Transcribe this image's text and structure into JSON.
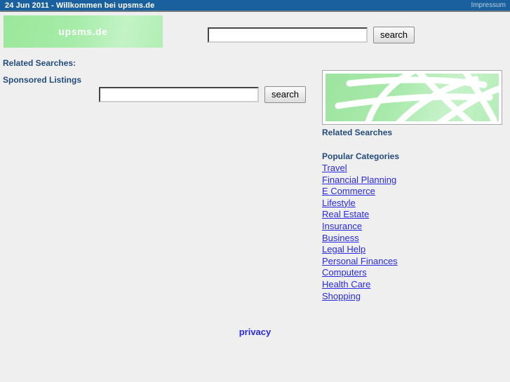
{
  "header": {
    "title": "24 Jun 2011 - Willkommen bei upsms.de",
    "impressum_label": "Impressum",
    "background_color": "#1a609e"
  },
  "logo": {
    "text": "upsms.de",
    "background_color": "#a7ecaa"
  },
  "top_search": {
    "value": "",
    "placeholder": "",
    "button_label": "search"
  },
  "main_search": {
    "value": "",
    "placeholder": "",
    "button_label": "search"
  },
  "left_column": {
    "related_searches_heading": "Related Searches:",
    "sponsored_listings_heading": "Sponsored Listings"
  },
  "banner": {
    "caption": "Related Searches",
    "graphic_name": "green-globe-grid",
    "graphic_color": "#a8e9ab"
  },
  "categories": {
    "heading": "Popular Categories",
    "items": [
      {
        "label": "Travel"
      },
      {
        "label": "Financial Planning"
      },
      {
        "label": "E Commerce"
      },
      {
        "label": "Lifestyle"
      },
      {
        "label": "Real Estate"
      },
      {
        "label": "Insurance"
      },
      {
        "label": "Business"
      },
      {
        "label": "Legal Help"
      },
      {
        "label": "Personal Finances"
      },
      {
        "label": "Computers"
      },
      {
        "label": "Health Care"
      },
      {
        "label": "Shopping"
      }
    ],
    "link_color": "#2a2ae0"
  },
  "footer": {
    "privacy_label": "privacy"
  }
}
